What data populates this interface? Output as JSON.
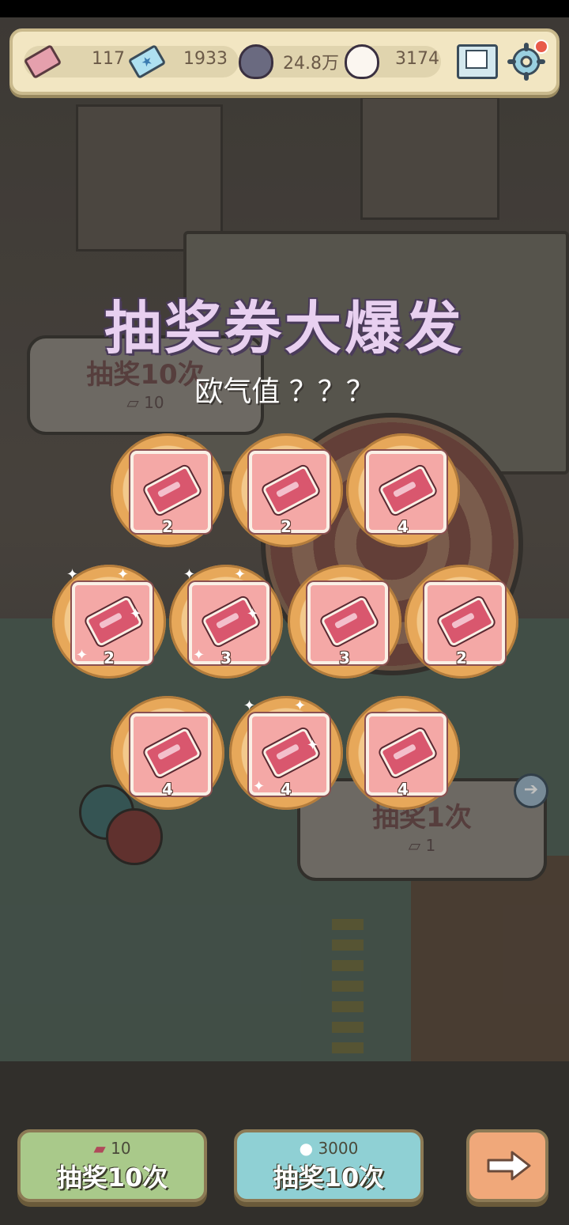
{
  "resources": {
    "tickets": "117",
    "stars": "1933",
    "dark_ghosts": "24.8万",
    "ghosts": "3174",
    "ticket_icon": "ticket-icon",
    "star_ticket_icon": "star-ticket-icon",
    "dark_ghost_icon": "dark-ghost-icon",
    "ghost_icon": "ghost-icon"
  },
  "background": {
    "sign_left_label": "抽奖10次",
    "sign_left_cost": "10",
    "sign_right_label": "抽奖1次",
    "sign_right_cost": "1"
  },
  "popup": {
    "title": "抽奖券大爆发",
    "luck_label": "欧气值 ？？？"
  },
  "rewards": [
    {
      "qty": "2",
      "sparkle": false
    },
    {
      "qty": "2",
      "sparkle": false
    },
    {
      "qty": "4",
      "sparkle": false
    },
    {
      "qty": "2",
      "sparkle": true
    },
    {
      "qty": "3",
      "sparkle": true
    },
    {
      "qty": "3",
      "sparkle": false
    },
    {
      "qty": "2",
      "sparkle": false
    },
    {
      "qty": "4",
      "sparkle": false
    },
    {
      "qty": "4",
      "sparkle": true
    },
    {
      "qty": "4",
      "sparkle": false
    }
  ],
  "buttons": {
    "draw_ticket_cost": "10",
    "draw_ticket_label": "抽奖10次",
    "draw_ghost_cost": "3000",
    "draw_ghost_label": "抽奖10次"
  },
  "colors": {
    "panel": "#f2e6c2",
    "green_button": "#a9c98a",
    "blue_button": "#8fd0d4",
    "next_button": "#f0a87a",
    "reward_ring": "#e7a85a",
    "ticket_card": "#f4a8a6"
  }
}
